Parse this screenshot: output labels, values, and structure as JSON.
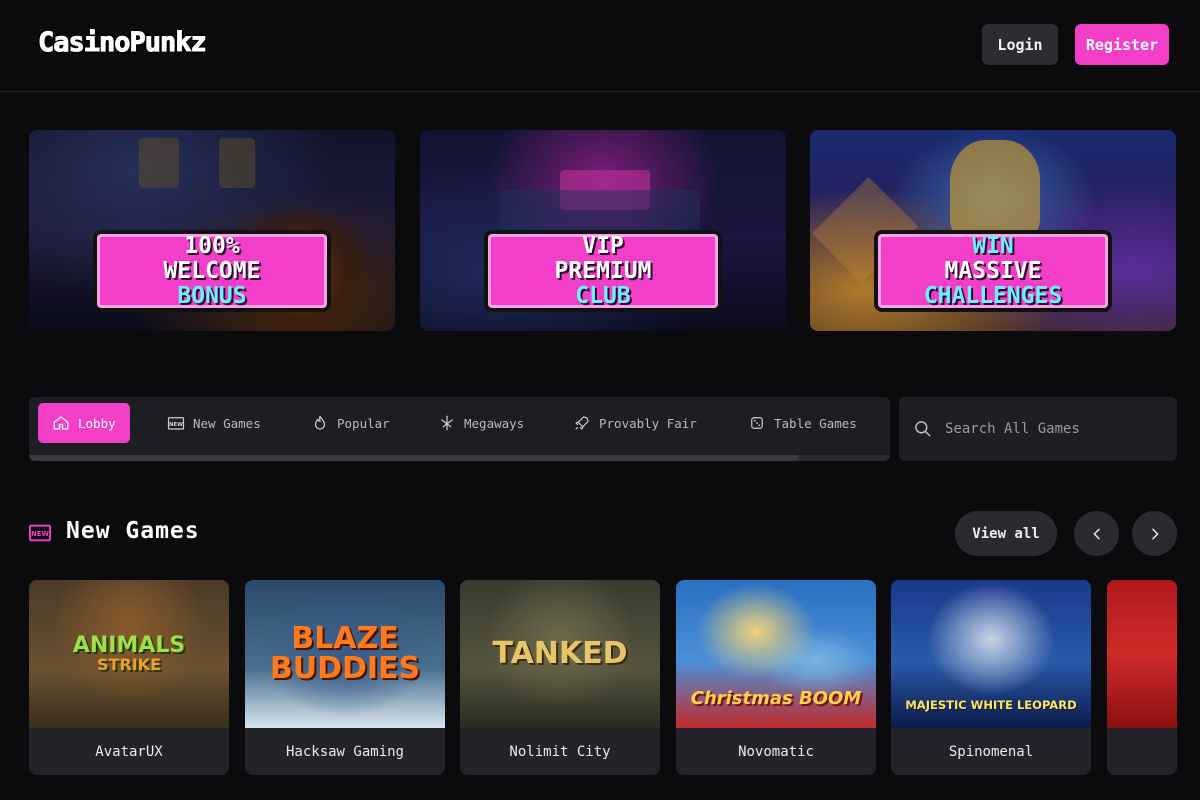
{
  "header": {
    "logo": "CasinoPunkz",
    "login_label": "Login",
    "register_label": "Register"
  },
  "banners": [
    {
      "lines": [
        "100%",
        "WELCOME",
        "BONUS"
      ]
    },
    {
      "lines": [
        "VIP",
        "PREMIUM",
        "CLUB"
      ]
    },
    {
      "lines": [
        "WIN",
        "MASSIVE",
        "CHALLENGES"
      ]
    }
  ],
  "categories": {
    "tabs": [
      {
        "label": "Lobby",
        "icon": "home-icon",
        "active": true
      },
      {
        "label": "New Games",
        "icon": "new-badge-icon"
      },
      {
        "label": "Popular",
        "icon": "flame-icon"
      },
      {
        "label": "Megaways",
        "icon": "megaways-icon"
      },
      {
        "label": "Provably Fair",
        "icon": "rocket-icon"
      },
      {
        "label": "Table Games",
        "icon": "dice-icon"
      }
    ],
    "search_placeholder": "Search All Games"
  },
  "section": {
    "title": "New Games",
    "view_all_label": "View all"
  },
  "games": [
    {
      "title_lines": [
        "ANIMALS",
        "STRIKE"
      ],
      "provider": "AvatarUX"
    },
    {
      "title_lines": [
        "BLAZE",
        "BUDDIES"
      ],
      "provider": "Hacksaw Gaming"
    },
    {
      "title_lines": [
        "TANKED"
      ],
      "provider": "Nolimit City"
    },
    {
      "title_lines": [
        "Christmas BOOM"
      ],
      "provider": "Novomatic"
    },
    {
      "title_lines": [
        "MAJESTIC WHITE LEOPARD"
      ],
      "provider": "Spinomenal"
    }
  ],
  "colors": {
    "accent": "#f33ec8",
    "background": "#0b0b0d",
    "surface": "#1d1e23"
  }
}
